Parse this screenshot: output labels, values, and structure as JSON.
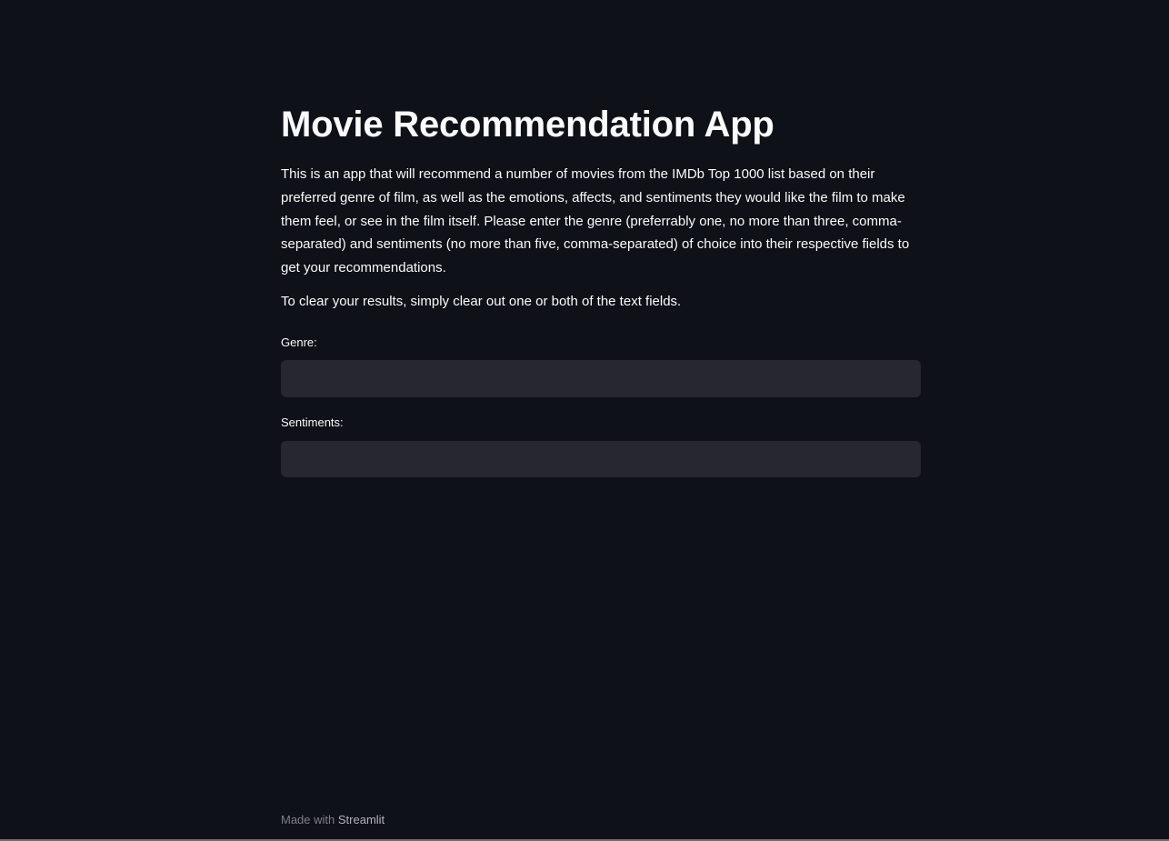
{
  "header": {
    "title": "Movie Recommendation App"
  },
  "content": {
    "description": "This is an app that will recommend a number of movies from the IMDb Top 1000 list based on their preferred genre of film, as well as the emotions, affects, and sentiments they would like the film to make them feel, or see in the film itself. Please enter the genre (preferrably one, no more than three, comma-separated) and sentiments (no more than five, comma-separated) of choice into their respective fields to get your recommendations.",
    "clear_hint": "To clear your results, simply clear out one or both of the text fields."
  },
  "form": {
    "genre": {
      "label": "Genre:",
      "value": "",
      "placeholder": ""
    },
    "sentiments": {
      "label": "Sentiments:",
      "value": "",
      "placeholder": ""
    }
  },
  "footer": {
    "prefix": "Made with",
    "brand": "Streamlit"
  },
  "colors": {
    "background": "#0e1117",
    "input_background": "#262730",
    "text": "#fafafa",
    "footer_text": "#7d7f85"
  }
}
